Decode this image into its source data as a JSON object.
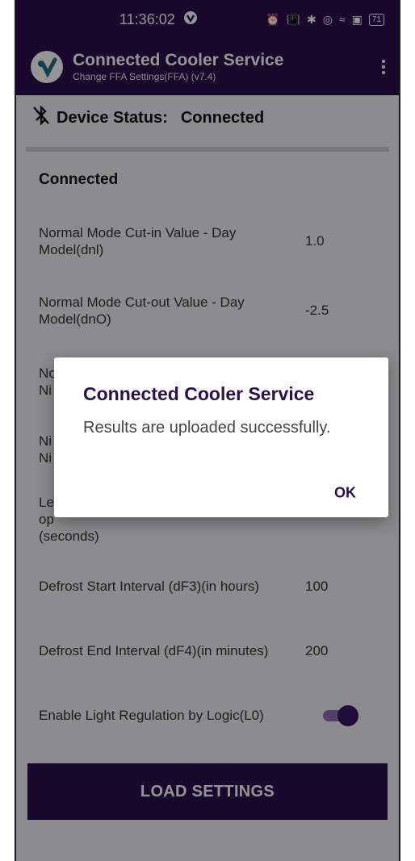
{
  "status_bar": {
    "time": "11:36:02",
    "battery": "71"
  },
  "app_bar": {
    "title": "Connected Cooler Service",
    "subtitle": "Change FFA Settings(FFA) (v7.4)"
  },
  "device_status": {
    "label": "Device Status:",
    "value": "Connected"
  },
  "section_title": "Connected",
  "settings": [
    {
      "label": "Normal Mode Cut-in Value - Day Model(dnl)",
      "value": "1.0"
    },
    {
      "label": "Normal Mode Cut-out Value - Day Model(dnO)",
      "value": "-2.5"
    },
    {
      "label": "Defrost Start Interval (dF3)(in hours)",
      "value": "100"
    },
    {
      "label": "Defrost End Interval (dF4)(in minutes)",
      "value": "200"
    },
    {
      "label": "Enable Light Regulation by Logic(L0)",
      "toggle_on": true
    }
  ],
  "partial_rows": {
    "row3_a": "No",
    "row3_b": "Ni",
    "row4_a": "Ni",
    "row4_b": "Ni",
    "row5_a": "Le",
    "row5_b": "op",
    "row5_c": "(seconds)"
  },
  "load_button": "LOAD SETTINGS",
  "dialog": {
    "title": "Connected Cooler Service",
    "message": "Results are uploaded successfully.",
    "ok": "OK"
  },
  "colors": {
    "primary": "#2a0f4d",
    "accent": "#3a1466"
  }
}
